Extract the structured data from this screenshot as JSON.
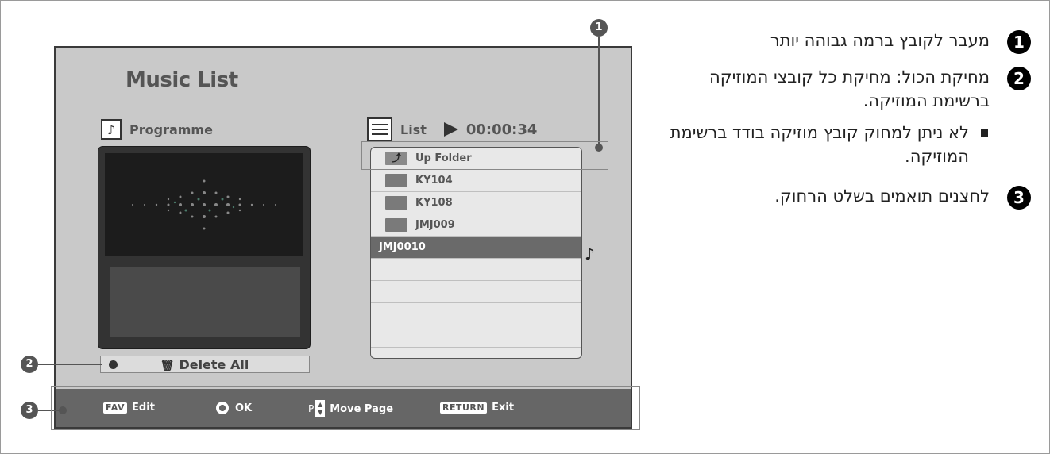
{
  "screen": {
    "title": "Music List",
    "programme": {
      "label": "Programme",
      "icon": "music-programme-icon"
    },
    "delete_all": {
      "label": "Delete All",
      "icon": "trash-icon"
    },
    "list": {
      "label": "List",
      "elapsed_time": "00:00:34",
      "items": [
        {
          "name": "Up Folder",
          "type": "up-folder"
        },
        {
          "name": "KY104",
          "type": "folder"
        },
        {
          "name": "KY108",
          "type": "folder"
        },
        {
          "name": "JMJ009",
          "type": "folder"
        },
        {
          "name": "JMJ0010",
          "type": "file",
          "selected": true,
          "playing": true
        }
      ],
      "empty_rows": 4
    },
    "bottom_bar": {
      "fav": {
        "key": "FAV",
        "label": "Edit"
      },
      "ok": {
        "label": "OK"
      },
      "page": {
        "key": "P",
        "label": "Move Page"
      },
      "return": {
        "key": "RETURN",
        "label": "Exit"
      }
    }
  },
  "callouts": [
    "1",
    "2",
    "3"
  ],
  "notes": {
    "n1": {
      "num": "1",
      "text": "מעבר לקובץ ברמה גבוהה יותר"
    },
    "n2": {
      "num": "2",
      "text": "מחיקת הכול: מחיקת כל קובצי המוזיקה ברשימת המוזיקה."
    },
    "bullet": "לא ניתן למחוק קובץ מוזיקה בודד ברשימת המוזיקה.",
    "n3": {
      "num": "3",
      "text": "לחצנים תואמים בשלט הרחוק."
    }
  },
  "colors": {
    "screen_bg": "#c9c9c9",
    "bar_bg": "#666666",
    "selected_row": "#6a6a6a"
  }
}
